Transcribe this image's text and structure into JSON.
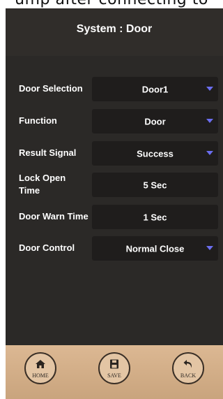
{
  "overlay_text": "ump after connecting to",
  "screen": {
    "title": "System : Door"
  },
  "rows": [
    {
      "label": "Door Selection",
      "value": "Door1",
      "dropdown": true
    },
    {
      "label": "Function",
      "value": "Door",
      "dropdown": true
    },
    {
      "label": "Result Signal",
      "value": "Success",
      "dropdown": true
    },
    {
      "label": "Lock Open Time",
      "value": "5 Sec",
      "dropdown": false
    },
    {
      "label": "Door Warn Time",
      "value": "1 Sec",
      "dropdown": false
    },
    {
      "label": "Door Control",
      "value": "Normal Close",
      "dropdown": true
    }
  ],
  "nav": {
    "home": {
      "label": "HOME",
      "icon": "home-icon"
    },
    "save": {
      "label": "SAVE",
      "icon": "save-icon"
    },
    "back": {
      "label": "BACK",
      "icon": "back-arrow-icon"
    }
  },
  "colors": {
    "accent": "#6b6ef0",
    "panel": "#2b2927",
    "footer": "#d4b08a"
  }
}
